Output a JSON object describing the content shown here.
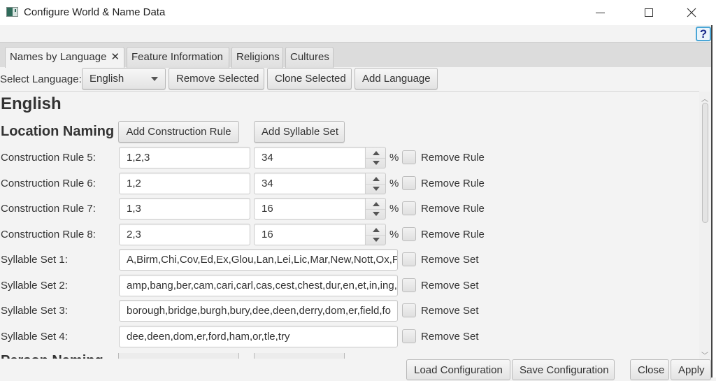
{
  "window": {
    "title": "Configure World & Name Data",
    "minimize_icon": "minimize-icon",
    "maximize_icon": "maximize-icon",
    "close_icon": "close-icon",
    "help_icon": "?"
  },
  "tabs": [
    {
      "label": "Names by Language",
      "active": true,
      "closable": true,
      "close_glyph": "✕"
    },
    {
      "label": "Feature Information",
      "active": false
    },
    {
      "label": "Religions",
      "active": false
    },
    {
      "label": "Cultures",
      "active": false
    }
  ],
  "toolbar": {
    "select_language_label": "Select Language:",
    "selected_language": "English",
    "remove_selected": "Remove Selected",
    "clone_selected": "Clone Selected",
    "add_language": "Add Language"
  },
  "content": {
    "language_heading": "English",
    "section_heading": "Location Naming",
    "add_construction_rule": "Add Construction Rule",
    "add_syllable_set": "Add Syllable Set",
    "percent_sign": "%",
    "construction_rules": [
      {
        "label": "Construction Rule 5:",
        "value": "1,2,3",
        "percent": "34",
        "remove_label": "Remove Rule",
        "checked": false
      },
      {
        "label": "Construction Rule 6:",
        "value": "1,2",
        "percent": "34",
        "remove_label": "Remove Rule",
        "checked": false
      },
      {
        "label": "Construction Rule 7:",
        "value": "1,3",
        "percent": "16",
        "remove_label": "Remove Rule",
        "checked": false
      },
      {
        "label": "Construction Rule 8:",
        "value": "2,3",
        "percent": "16",
        "remove_label": "Remove Rule",
        "checked": false
      }
    ],
    "syllable_sets": [
      {
        "label": "Syllable Set 1:",
        "value": "A,Birm,Chi,Cov,Ed,Ex,Glou,Lan,Lei,Lic,Mar,New,Nott,Ox,Pe",
        "remove_label": "Remove Set",
        "checked": false
      },
      {
        "label": "Syllable Set 2:",
        "value": "amp,bang,ber,cam,cari,carl,cas,cest,chest,dur,en,et,in,ing,i",
        "remove_label": "Remove Set",
        "checked": false
      },
      {
        "label": "Syllable Set 3:",
        "value": "borough,bridge,burgh,bury,dee,deen,derry,dom,er,field,fo",
        "remove_label": "Remove Set",
        "checked": false
      },
      {
        "label": "Syllable Set 4:",
        "value": "dee,deen,dom,er,ford,ham,or,tle,try",
        "remove_label": "Remove Set",
        "checked": false
      }
    ],
    "next_section_partial": "Person Naming"
  },
  "footer": {
    "load_configuration": "Load Configuration",
    "save_configuration": "Save Configuration",
    "close": "Close",
    "apply": "Apply"
  }
}
